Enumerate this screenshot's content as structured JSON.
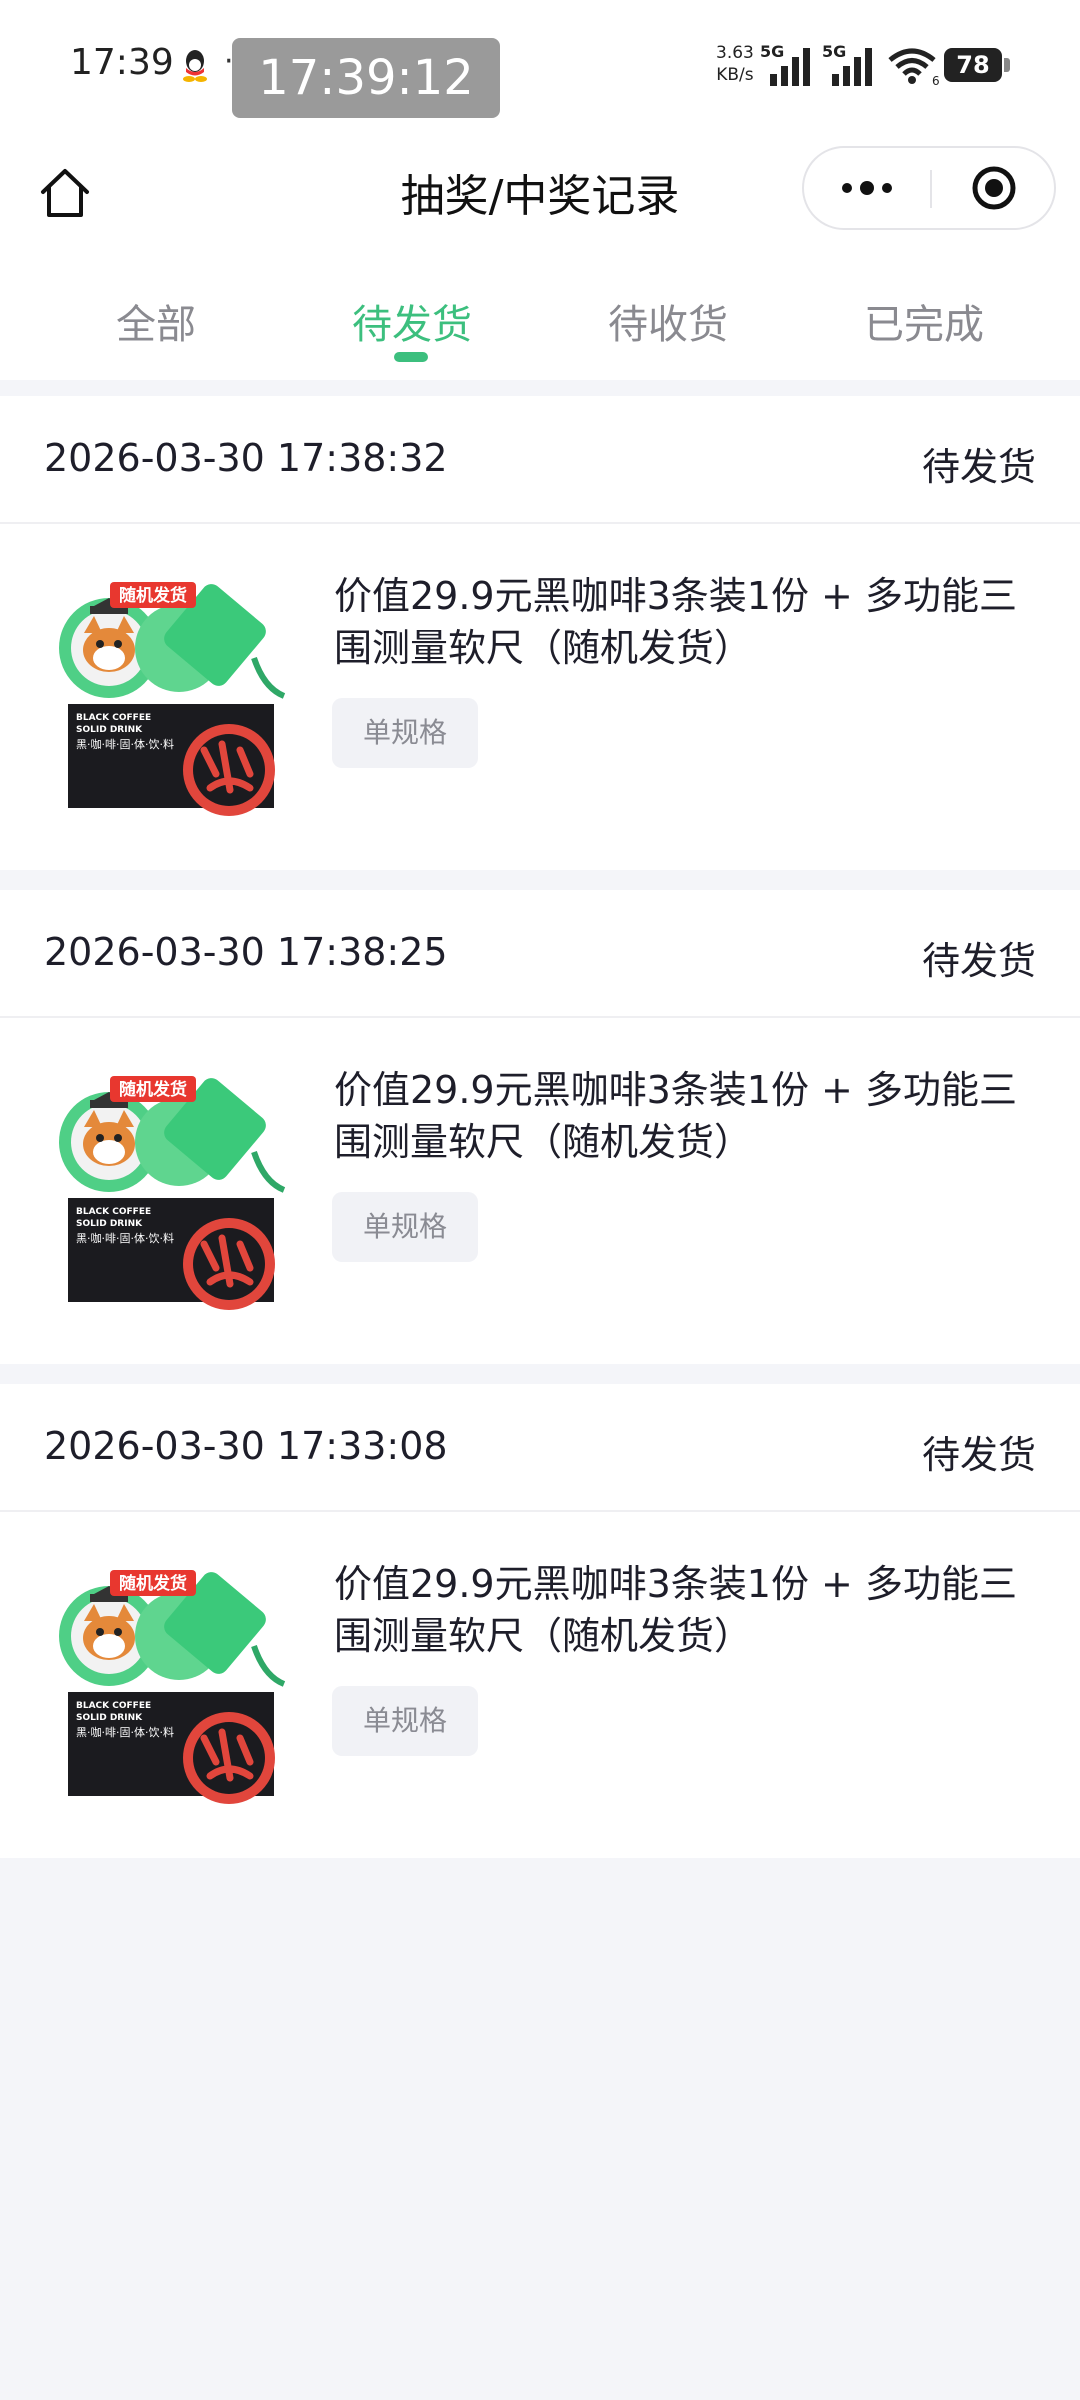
{
  "status_bar": {
    "time": "17:39",
    "overlay_time": "17:39:12",
    "speed_value": "3.63",
    "speed_unit": "KB/s",
    "sim1_label": "5G",
    "sim2_label": "5G",
    "wifi_badge": "6",
    "battery": "78"
  },
  "nav": {
    "title": "抽奖/中奖记录"
  },
  "tabs": [
    {
      "label": "全部",
      "active": false
    },
    {
      "label": "待发货",
      "active": true
    },
    {
      "label": "待收货",
      "active": false
    },
    {
      "label": "已完成",
      "active": false
    }
  ],
  "orders": [
    {
      "datetime": "2026-03-30 17:38:32",
      "status": "待发货",
      "title": "价值29.9元黑咖啡3条装1份 + 多功能三围测量软尺（随机发货）",
      "spec": "单规格",
      "image_tag": "随机发货",
      "image_text_1": "BLACK COFFEE",
      "image_text_2": "SOLID DRINK",
      "image_text_3": "黑·咖·啡·固·体·饮·料"
    },
    {
      "datetime": "2026-03-30 17:38:25",
      "status": "待发货",
      "title": "价值29.9元黑咖啡3条装1份 + 多功能三围测量软尺（随机发货）",
      "spec": "单规格",
      "image_tag": "随机发货",
      "image_text_1": "BLACK COFFEE",
      "image_text_2": "SOLID DRINK",
      "image_text_3": "黑·咖·啡·固·体·饮·料"
    },
    {
      "datetime": "2026-03-30 17:33:08",
      "status": "待发货",
      "title": "价值29.9元黑咖啡3条装1份 + 多功能三围测量软尺（随机发货）",
      "spec": "单规格",
      "image_tag": "随机发货",
      "image_text_1": "BLACK COFFEE",
      "image_text_2": "SOLID DRINK",
      "image_text_3": "黑·咖·啡·固·体·饮·料"
    }
  ],
  "colors": {
    "accent": "#3cbf7e",
    "background": "#f4f5f9",
    "text_primary": "#1e1e2a",
    "text_muted": "#8a8a90"
  },
  "icons": {
    "home": "home-icon",
    "more": "more-dots-icon",
    "close": "target-circle-icon"
  }
}
